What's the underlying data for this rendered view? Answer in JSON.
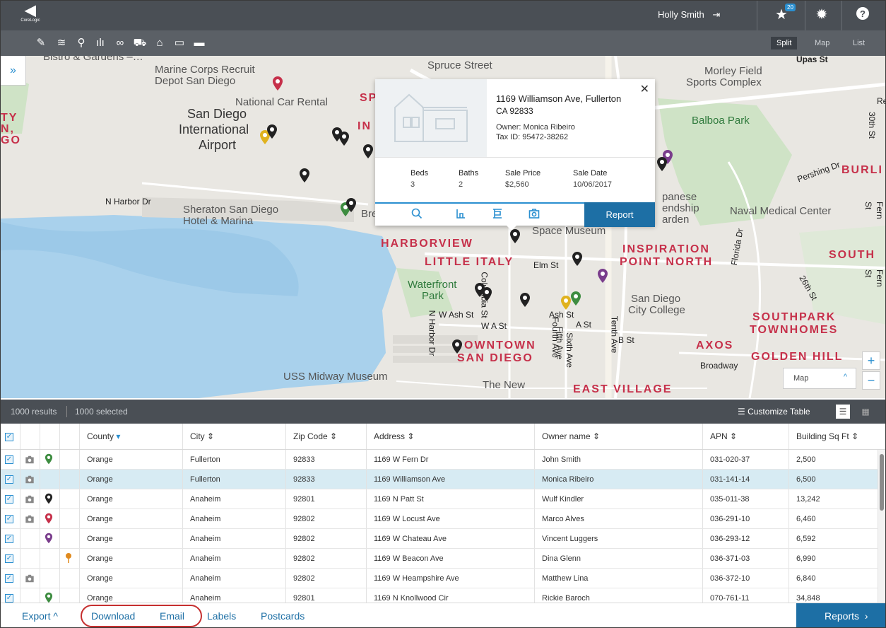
{
  "header": {
    "logo_text": "CoreLogic",
    "user_name": "Holly Smith",
    "logout_glyph": "⇥",
    "favorites_count": "20",
    "icons": [
      "star-icon",
      "gear-icon",
      "help-icon"
    ]
  },
  "toolbar": {
    "tools": [
      "pencil-icon",
      "layers-icon",
      "pin-icon",
      "chart-icon",
      "binoculars-icon",
      "car-icon",
      "map-compare-icon",
      "comment-icon",
      "ruler-icon"
    ],
    "views": [
      "Split",
      "Map",
      "List"
    ],
    "active_view": "Split"
  },
  "map": {
    "labels": {
      "bistro": "Bistro & Gardens –…",
      "marine_1": "Marine Corps Recruit",
      "marine_2": "Depot San Diego",
      "car_rental": "National Car Rental",
      "sd_1": "San Diego",
      "sd_2": "International",
      "sd_3": "Airport",
      "harbor": "N Harbor Dr",
      "sheraton_1": "Sheraton San Diego",
      "sheraton_2": "Hotel & Marina",
      "spruce": "Spruce Street",
      "morley_1": "Morley Field",
      "morley_2": "Sports Complex",
      "balboa": "Balboa Park",
      "naval": "Naval Medical Center",
      "japanese_1": "panese",
      "japanese_2": "endship",
      "japanese_3": "arden",
      "space": "Space Museum",
      "harborview": "HARBORVIEW",
      "little_italy": "LITTLE ITALY",
      "elm": "Elm St",
      "inspiration_1": "INSPIRATION",
      "inspiration_2": "POINT NORTH",
      "south": "SOUTH",
      "waterfront_1": "Waterfront",
      "waterfront_2": "Park",
      "w_ash": "W Ash St",
      "w_a": "W A St",
      "ash": "Ash St",
      "a_st": "A St",
      "b_st": "B St",
      "sd_college_1": "San Diego",
      "sd_college_2": "City College",
      "southpark_1": "SOUTHPARK",
      "southpark_2": "TOWNHOMES",
      "axos": "AXOS",
      "golden_hill": "GOLDEN HILL",
      "broadway": "Broadway",
      "downtown_1": "OWNTOWN",
      "downtown_2": "SAN DIEGO",
      "midway": "USS Midway Museum",
      "the_new": "The New",
      "east_village": "EAST VILLAGE",
      "upas": "Upas St",
      "burl": "BURLI",
      "pershing": "Pershing Dr",
      "ty": "TY",
      "n": "N,",
      "go": "GO",
      "st30": "30th St",
      "fern": "Fern St",
      "fern2": "Fern St",
      "florida": "Florida Dr",
      "st26": "26th St",
      "re": "Re",
      "n_harbor_v": "N Harbor Dr",
      "columbia": "Columbia St",
      "fifth": "Fifth Ave",
      "fourth": "Fourth Ave",
      "sixth": "Sixth Ave",
      "tenth": "Tenth Ave",
      "bre": "Bre",
      "sp": "SP",
      "in": "IN"
    },
    "map_type": "Map",
    "zoom_in": "+",
    "zoom_out": "−",
    "expand_glyph": "»"
  },
  "popup": {
    "address_line1": "1169 Williamson Ave, Fullerton",
    "address_line2": "CA 92833",
    "owner_label": "Owner:",
    "owner_value": "Monica Ribeiro",
    "tax_label": "Tax ID:",
    "tax_value": "95472-38262",
    "stats": [
      {
        "label": "Beds",
        "value": "3"
      },
      {
        "label": "Baths",
        "value": "2"
      },
      {
        "label": "Sale Price",
        "value": "$2,560"
      },
      {
        "label": "Sale Date",
        "value": "10/06/2017"
      }
    ],
    "report_label": "Report",
    "close_glyph": "✕"
  },
  "results": {
    "count": "1000 results",
    "selected": "1000 selected",
    "customize": "Customize Table"
  },
  "table": {
    "columns": [
      "County",
      "City",
      "Zip Code",
      "Address",
      "Owner name",
      "APN",
      "Building Sq Ft"
    ],
    "sort_glyph": "⇕",
    "county_sort_glyph": "▾",
    "rows": [
      {
        "camera": true,
        "pin": "#3d8c40",
        "flag": "",
        "county": "Orange",
        "city": "Fullerton",
        "zip": "92833",
        "address": "1169 W Fern Dr",
        "owner": "John Smith",
        "apn": "031-020-37",
        "sqft": "2,500",
        "selected": false
      },
      {
        "camera": true,
        "pin": "",
        "flag": "",
        "county": "Orange",
        "city": "Fullerton",
        "zip": "92833",
        "address": "1169 Williamson Ave",
        "owner": "Monica Ribeiro",
        "apn": "031-141-14",
        "sqft": "6,500",
        "selected": true
      },
      {
        "camera": true,
        "pin": "#222222",
        "flag": "",
        "county": "Orange",
        "city": "Anaheim",
        "zip": "92801",
        "address": "1169 N Patt St",
        "owner": "Wulf Kindler",
        "apn": "035-011-38",
        "sqft": "13,242",
        "selected": false
      },
      {
        "camera": true,
        "pin": "#c6304a",
        "flag": "",
        "county": "Orange",
        "city": "Anaheim",
        "zip": "92802",
        "address": "1169 W Locust Ave",
        "owner": "Marco Alves",
        "apn": "036-291-10",
        "sqft": "6,460",
        "selected": false
      },
      {
        "camera": false,
        "pin": "#7a3d8c",
        "flag": "",
        "county": "Orange",
        "city": "Anaheim",
        "zip": "92802",
        "address": "1169 W Chateau Ave",
        "owner": "Vincent Luggers",
        "apn": "036-293-12",
        "sqft": "6,592",
        "selected": false
      },
      {
        "camera": false,
        "pin": "",
        "flag": "#e08a1e",
        "county": "Orange",
        "city": "Anaheim",
        "zip": "92802",
        "address": "1169 W Beacon Ave",
        "owner": "Dina Glenn",
        "apn": "036-371-03",
        "sqft": "6,990",
        "selected": false
      },
      {
        "camera": true,
        "pin": "",
        "flag": "",
        "county": "Orange",
        "city": "Anaheim",
        "zip": "92802",
        "address": "1169 W Heampshire Ave",
        "owner": "Matthew Lina",
        "apn": "036-372-10",
        "sqft": "6,840",
        "selected": false
      },
      {
        "camera": false,
        "pin": "#3d8c40",
        "flag": "",
        "county": "Orange",
        "city": "Anaheim",
        "zip": "92801",
        "address": "1169 N Knollwood Cir",
        "owner": "Rickie Baroch",
        "apn": "070-761-11",
        "sqft": "34,848",
        "selected": false
      }
    ]
  },
  "footer": {
    "export": "Export",
    "export_glyph": "^",
    "download": "Download",
    "email": "Email",
    "labels": "Labels",
    "postcards": "Postcards",
    "reports": "Reports",
    "reports_glyph": "›"
  }
}
